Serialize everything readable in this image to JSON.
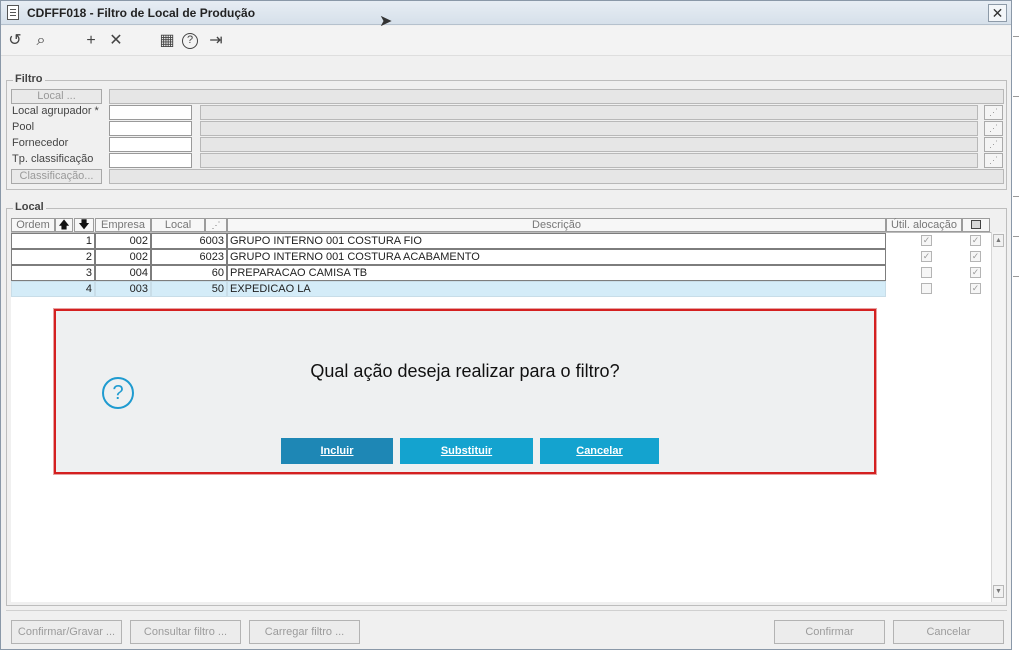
{
  "window": {
    "title": "CDFFF018 - Filtro de Local de Produção"
  },
  "toolbar": {
    "icons": [
      "undo-icon",
      "search-icon",
      "add-icon",
      "delete-icon",
      "calendar-icon",
      "help-icon",
      "exit-icon"
    ],
    "glyphs": {
      "undo": "↺",
      "search": "⌕",
      "add": "+",
      "delete": "✕",
      "calendar": "▦",
      "help": "?",
      "exit": "⇥"
    }
  },
  "filtro": {
    "legend": "Filtro",
    "local_button": "Local ...",
    "fields": [
      {
        "label": "Local agrupador *",
        "value": ""
      },
      {
        "label": "Pool",
        "value": ""
      },
      {
        "label": "Fornecedor",
        "value": ""
      },
      {
        "label": "Tp. classificação",
        "value": ""
      }
    ],
    "classificacao_button": "Classificação..."
  },
  "local": {
    "legend": "Local",
    "columns": {
      "ordem": "Ordem",
      "up": "🡅",
      "down": "🡇",
      "empresa": "Empresa",
      "local": "Local",
      "descricao": "Descrição",
      "util_alocacao": "Útil. alocação"
    },
    "rows": [
      {
        "ordem": "1",
        "empresa": "002",
        "local": "6003",
        "descricao": "GRUPO INTERNO 001 COSTURA FIO",
        "util": true,
        "sel": true
      },
      {
        "ordem": "2",
        "empresa": "002",
        "local": "6023",
        "descricao": "GRUPO INTERNO 001 COSTURA ACABAMENTO",
        "util": true,
        "sel": true
      },
      {
        "ordem": "3",
        "empresa": "004",
        "local": "60",
        "descricao": "PREPARACAO CAMISA TB",
        "util": false,
        "sel": true
      },
      {
        "ordem": "4",
        "empresa": "003",
        "local": "50",
        "descricao": "EXPEDICAO LA",
        "util": false,
        "sel": true
      }
    ]
  },
  "dialog": {
    "message": "Qual ação deseja realizar para o filtro?",
    "icon": "?",
    "buttons": {
      "incluir": "Incluir",
      "substituir": "Substituir",
      "cancelar": "Cancelar"
    },
    "colors": {
      "incluir": "#1e87b5",
      "substituir": "#14a3cf",
      "cancelar": "#14a3cf",
      "border": "#d42020"
    }
  },
  "footer": {
    "confirmar_gravar": "Confirmar/Gravar ...",
    "consultar_filtro": "Consultar filtro ...",
    "carregar_filtro": "Carregar filtro ...",
    "confirmar": "Confirmar",
    "cancelar": "Cancelar"
  }
}
